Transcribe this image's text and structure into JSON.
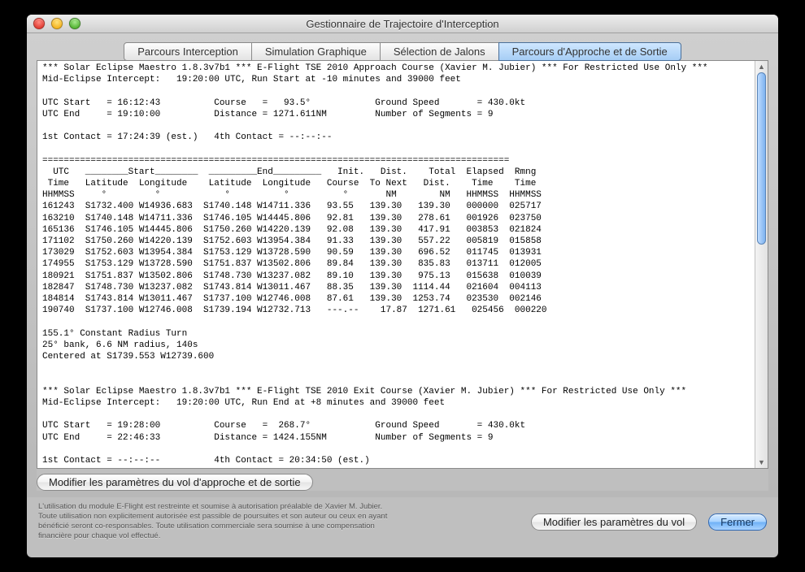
{
  "window": {
    "title": "Gestionnaire de Trajectoire d'Interception"
  },
  "tabs": [
    {
      "label": "Parcours Interception"
    },
    {
      "label": "Simulation Graphique"
    },
    {
      "label": "Sélection de Jalons"
    },
    {
      "label": "Parcours d'Approche et de Sortie"
    }
  ],
  "report": {
    "text": "*** Solar Eclipse Maestro 1.8.3v7b1 *** E-Flight TSE 2010 Approach Course (Xavier M. Jubier) *** For Restricted Use Only ***\nMid-Eclipse Intercept:   19:20:00 UTC, Run Start at -10 minutes and 39000 feet\n\nUTC Start   = 16:12:43          Course   =   93.5°            Ground Speed       = 430.0kt\nUTC End     = 19:10:00          Distance = 1271.611NM         Number of Segments = 9\n\n1st Contact = 17:24:39 (est.)   4th Contact = --:--:--\n\n=======================================================================================\n  UTC   ________Start________  _________End_________   Init.   Dist.    Total  Elapsed  Rmng\n Time   Latitude  Longitude    Latitude  Longitude   Course  To Next   Dist.    Time    Time\nHHMMSS     °         °            °          °          °       NM        NM   HHMMSS  HHMMSS\n161243  S1732.400 W14936.683  S1740.148 W14711.336   93.55   139.30   139.30   000000  025717\n163210  S1740.148 W14711.336  S1746.105 W14445.806   92.81   139.30   278.61   001926  023750\n165136  S1746.105 W14445.806  S1750.260 W14220.139   92.08   139.30   417.91   003853  021824\n171102  S1750.260 W14220.139  S1752.603 W13954.384   91.33   139.30   557.22   005819  015858\n173029  S1752.603 W13954.384  S1753.129 W13728.590   90.59   139.30   696.52   011745  013931\n174955  S1753.129 W13728.590  S1751.837 W13502.806   89.84   139.30   835.83   013711  012005\n180921  S1751.837 W13502.806  S1748.730 W13237.082   89.10   139.30   975.13   015638  010039\n182847  S1748.730 W13237.082  S1743.814 W13011.467   88.35   139.30  1114.44   021604  004113\n184814  S1743.814 W13011.467  S1737.100 W12746.008   87.61   139.30  1253.74   023530  002146\n190740  S1737.100 W12746.008  S1739.194 W12732.713   ---.--    17.87  1271.61   025456  000220\n\n155.1° Constant Radius Turn\n25° bank, 6.6 NM radius, 140s\nCentered at S1739.553 W12739.600\n\n\n*** Solar Eclipse Maestro 1.8.3v7b1 *** E-Flight TSE 2010 Exit Course (Xavier M. Jubier) *** For Restricted Use Only ***\nMid-Eclipse Intercept:   19:20:00 UTC, Run End at +8 minutes and 39000 feet\n\nUTC Start   = 19:28:00          Course   =  268.7°            Ground Speed       = 430.0kt\nUTC End     = 22:46:33          Distance = 1424.155NM         Number of Segments = 9\n\n1st Contact = --:--:--          4th Contact = 20:34:50 (est.)"
  },
  "buttons": {
    "modify_approach": "Modifier les paramètres du vol d'approche et de sortie",
    "modify_flight": "Modifier les paramètres du vol",
    "close": "Fermer"
  },
  "disclaimer": "L'utilisation du module E-Flight est restreinte et soumise à autorisation préalable de Xavier M. Jubier.\nToute utilisation non explicitement autorisée est passible de poursuites et son auteur ou ceux en ayant\nbénéficié seront co-responsables. Toute utilisation commerciale sera soumise à une compensation\nfinancière pour chaque vol effectué."
}
